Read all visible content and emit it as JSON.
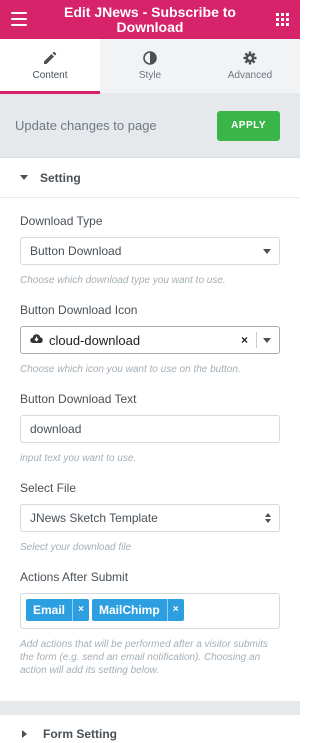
{
  "header": {
    "title": "Edit JNews - Subscribe to Download",
    "menu_icon": "hamburger-icon",
    "apps_icon": "grid-icon"
  },
  "tabs": [
    {
      "label": "Content",
      "icon": "pencil-icon",
      "active": true
    },
    {
      "label": "Style",
      "icon": "half-circle-icon",
      "active": false
    },
    {
      "label": "Advanced",
      "icon": "gear-icon",
      "active": false
    }
  ],
  "update_bar": {
    "text": "Update changes to page",
    "apply_label": "APPLY"
  },
  "section_setting": {
    "title": "Setting",
    "download_type": {
      "label": "Download Type",
      "value": "Button Download",
      "help": "Choose which download type you want to use."
    },
    "download_icon": {
      "label": "Button Download Icon",
      "value": "cloud-download",
      "clear": "×",
      "help": "Choose which icon you want to use on the button."
    },
    "download_text": {
      "label": "Button Download Text",
      "value": "download",
      "help": "input text you want to use."
    },
    "select_file": {
      "label": "Select File",
      "value": "JNews Sketch Template",
      "help": "Select your download file"
    },
    "actions": {
      "label": "Actions After Submit",
      "chips": [
        {
          "label": "Email",
          "remove": "×"
        },
        {
          "label": "MailChimp",
          "remove": "×"
        }
      ],
      "help": "Add actions that will be performed after a visitor submits the form (e.g. send an email notification). Choosing an action will add its setting below."
    }
  },
  "section_form": {
    "title": "Form Setting"
  },
  "colors": {
    "brand": "#d6236a",
    "apply": "#39b54a",
    "chip": "#2d9fe0"
  }
}
